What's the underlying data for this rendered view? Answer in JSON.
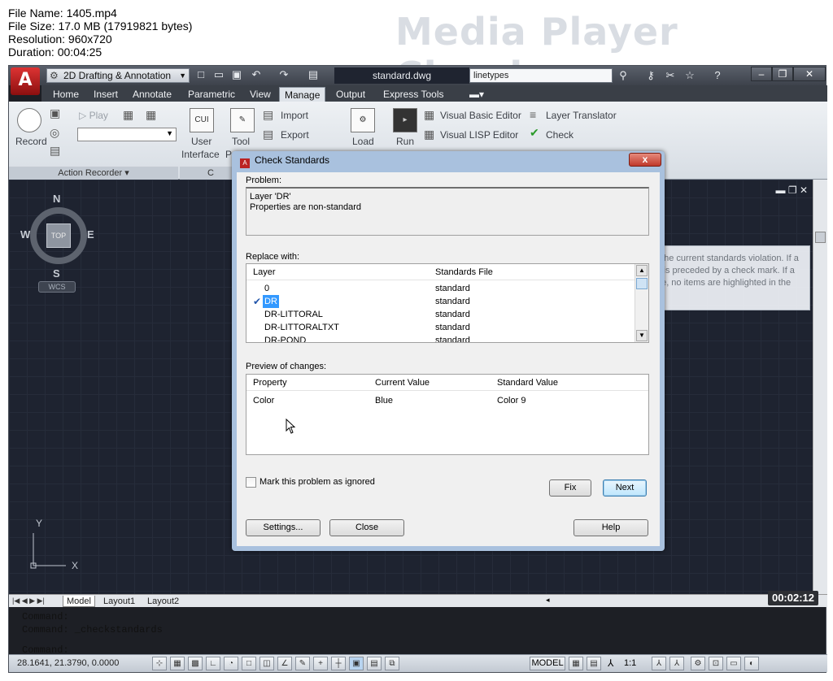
{
  "overlay": {
    "file_name": "File Name: 1405.mp4",
    "file_size": "File Size: 17.0 MB (17919821 bytes)",
    "resolution": "Resolution: 960x720",
    "duration": "Duration: 00:04:25",
    "watermark": "Media Player Classic",
    "time": "00:02:12"
  },
  "titlebar": {
    "app_button": "A",
    "workspace": "2D Drafting & Annotation",
    "doc_title": "standard.dwg",
    "search_text": "linetypes"
  },
  "tabs": [
    {
      "label": "Home"
    },
    {
      "label": "Insert"
    },
    {
      "label": "Annotate"
    },
    {
      "label": "Parametric"
    },
    {
      "label": "View"
    },
    {
      "label": "Manage"
    },
    {
      "label": "Output"
    },
    {
      "label": "Express Tools"
    }
  ],
  "ribbon": {
    "record": "Record",
    "play": "Play",
    "action_recorder": "Action Recorder",
    "user_interface_1": "User",
    "user_interface_2": "Interface",
    "tool": "Tool",
    "tool_p": "P",
    "cui": "CUI",
    "import": "Import",
    "export": "Export",
    "load": "Load",
    "run": "Run",
    "vba_editor": "Visual Basic Editor",
    "lisp_editor": "Visual LISP Editor",
    "layer_translator": "Layer Translator",
    "check": "Check"
  },
  "viewcube": {
    "top": "TOP",
    "n": "N",
    "s": "S",
    "e": "E",
    "w": "W",
    "wcs": "WCS"
  },
  "ucs": {
    "x": "X",
    "y": "Y"
  },
  "tooltip": {
    "text": "Lists possible replacements for the current standards violation. If a recommended fix is available, it is preceded by a check mark. If a recommended fix is not available, no items are highlighted in the Replace With list."
  },
  "layout_tabs": [
    {
      "label": "Model"
    },
    {
      "label": "Layout1"
    },
    {
      "label": "Layout2"
    }
  ],
  "command": {
    "line1": "Command:",
    "line2": "Command: _checkstandards",
    "line3": "Command:"
  },
  "status": {
    "coords": "28.1641, 21.3790, 0.0000",
    "model": "MODEL",
    "scale": "1:1"
  },
  "dialog": {
    "title": "Check Standards",
    "close": "x",
    "problem_label": "Problem:",
    "problem_line1": "Layer 'DR'",
    "problem_line2": "Properties are non-standard",
    "replace_label": "Replace with:",
    "replace_headers": {
      "col1": "Layer",
      "col2": "Standards File"
    },
    "replace_rows": [
      {
        "layer": "0",
        "file": "standard"
      },
      {
        "layer": "DR",
        "file": "standard"
      },
      {
        "layer": "DR-LITTORAL",
        "file": "standard"
      },
      {
        "layer": "DR-LITTORALTXT",
        "file": "standard"
      },
      {
        "layer": "DR-POND",
        "file": "standard"
      }
    ],
    "preview_label": "Preview of changes:",
    "preview_headers": {
      "col1": "Property",
      "col2": "Current Value",
      "col3": "Standard Value"
    },
    "preview_rows": [
      {
        "property": "Color",
        "current": "Blue",
        "standard": "Color 9"
      }
    ],
    "ignore_label": "Mark this problem as ignored",
    "fix": "Fix",
    "next": "Next",
    "settings": "Settings...",
    "close_btn": "Close",
    "help": "Help"
  },
  "colors": {
    "canvas": "#1e2330",
    "selection": "#3399ff",
    "dialog_border": "#a9c1de"
  }
}
